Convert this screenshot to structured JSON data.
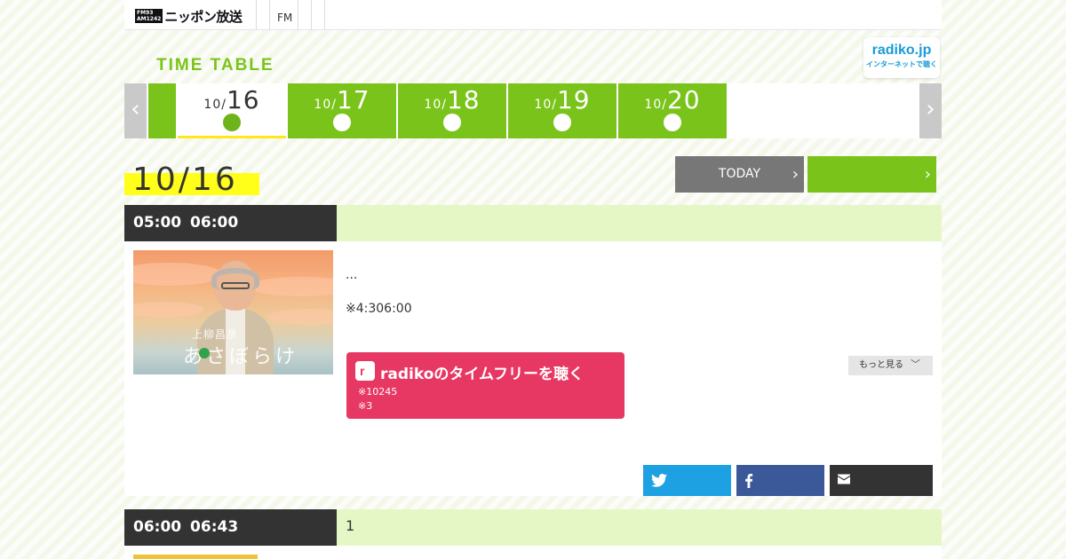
{
  "header": {
    "logo_badge_top": "FM93",
    "logo_badge_bottom": "AM1242",
    "logo_text": "ニッポン放送",
    "nav_fm": "FM"
  },
  "timetable": {
    "title": "TIME TABLE",
    "radiko_badge_title": "radiko.jp",
    "radiko_badge_sub": "インターネットで聴く",
    "prev_arrow": "‹",
    "next_arrow": "›"
  },
  "date_tabs": [
    {
      "month": "10/",
      "day": "16",
      "active": true
    },
    {
      "month": "10/",
      "day": "17",
      "active": false
    },
    {
      "month": "10/",
      "day": "18",
      "active": false
    },
    {
      "month": "10/",
      "day": "19",
      "active": false
    },
    {
      "month": "10/",
      "day": "20",
      "active": false
    }
  ],
  "current_date": "10/16",
  "today_button": "TODAY",
  "programs": [
    {
      "time": "05:00  06:00",
      "title": "",
      "thumbnail_caption_small": "上柳昌彦",
      "thumbnail_caption_large": "あさぼらけ",
      "desc1": "...",
      "desc2": "※4:306:00",
      "radiko_button": "radikoのタイムフリーを聴く",
      "radiko_note1": "※10245",
      "radiko_note2": "※3",
      "more_button": "もっと見る"
    },
    {
      "time": "06:00  06:43",
      "title": "1"
    }
  ],
  "colors": {
    "green": "#7ac31a",
    "radiko_pink": "#e73863",
    "twitter": "#1da1e2",
    "facebook": "#3b5998"
  }
}
